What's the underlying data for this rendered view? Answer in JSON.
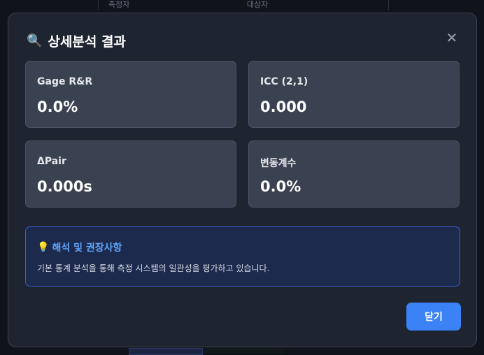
{
  "background": {
    "header_labels": [
      "측정자",
      "대상자"
    ]
  },
  "modal": {
    "title": "상세분석 결과",
    "title_icon": "magnifier-icon",
    "close_icon": "close-icon",
    "close_symbol": "✕",
    "stats": [
      {
        "label": "Gage R&R",
        "value": "0.0%"
      },
      {
        "label": "ICC (2,1)",
        "value": "0.000"
      },
      {
        "label": "ΔPair",
        "value": "0.000s"
      },
      {
        "label": "변동계수",
        "value": "0.0%"
      }
    ],
    "info": {
      "icon": "lightbulb-icon",
      "title": "해석 및 권장사항",
      "text": "기본 통계 분석을 통해 측정 시스템의 일관성을 평가하고 있습니다."
    },
    "close_button_label": "닫기"
  },
  "colors": {
    "modal_bg": "#1f2530",
    "card_bg": "#3a4150",
    "accent": "#3b82f6",
    "info_title": "#60a5fa",
    "info_border": "#3b5bd1"
  }
}
